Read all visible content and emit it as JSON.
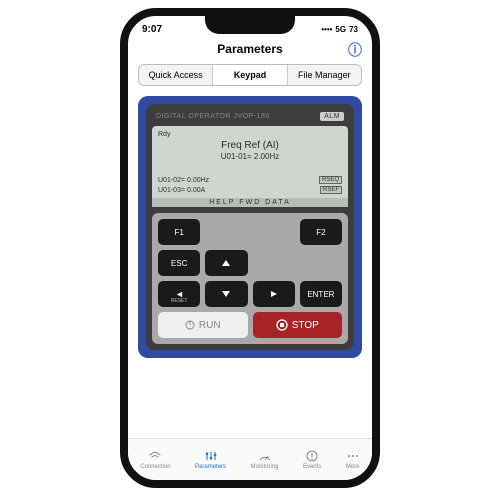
{
  "status": {
    "time": "9:07",
    "network": "5G",
    "battery": "73"
  },
  "nav": {
    "title": "Parameters"
  },
  "segments": {
    "quick": "Quick Access",
    "keypad": "Keypad",
    "file": "File Manager"
  },
  "operator": {
    "model": "DIGITAL OPERATOR JVOP-180",
    "alm": "ALM",
    "rdy": "Rdy",
    "main_title": "Freq Ref (AI)",
    "main_sub": "U01-01= 2.00Hz",
    "rows": [
      {
        "label": "U01-02= 0.00Hz",
        "badge": "RSEQ"
      },
      {
        "label": "U01-03= 0.00A",
        "badge": "RSEF"
      }
    ],
    "footer": "HELP  FWD  DATA"
  },
  "keys": {
    "f1": "F1",
    "f2": "F2",
    "esc": "ESC",
    "enter": "ENTER",
    "reset": "RESET",
    "run": "RUN",
    "stop": "STOP"
  },
  "tabs": {
    "connection": "Connection",
    "parameters": "Parameters",
    "monitoring": "Monitoring",
    "events": "Events",
    "more": "More"
  }
}
